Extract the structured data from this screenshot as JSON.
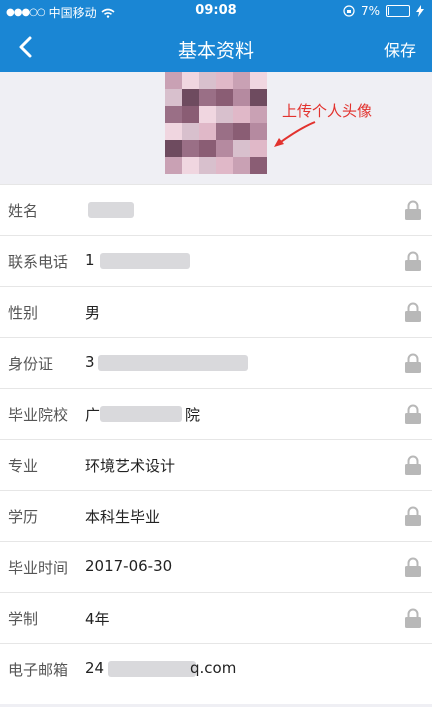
{
  "status_bar": {
    "carrier": "中国移动",
    "time": "09:08",
    "battery": "7%",
    "battery_level": 0.07
  },
  "nav": {
    "title": "基本资料",
    "save_label": "保存"
  },
  "avatar": {
    "annotation": "上传个人头像"
  },
  "fields": [
    {
      "label": "姓名",
      "value": ""
    },
    {
      "label": "联系电话",
      "value": "1"
    },
    {
      "label": "性别",
      "value": "男"
    },
    {
      "label": "身份证",
      "value": "3"
    },
    {
      "label": "毕业院校",
      "value": "广"
    },
    {
      "label": "专业",
      "value": "环境艺术设计"
    },
    {
      "label": "学历",
      "value": "本科生毕业"
    },
    {
      "label": "毕业时间",
      "value": "2017-06-30"
    },
    {
      "label": "学制",
      "value": "4年"
    },
    {
      "label": "电子邮箱",
      "value": "24"
    }
  ],
  "field_tails": {
    "school": "院",
    "email": "q.com"
  },
  "colors": {
    "primary": "#1a86d4",
    "annotation": "#e2322e"
  }
}
